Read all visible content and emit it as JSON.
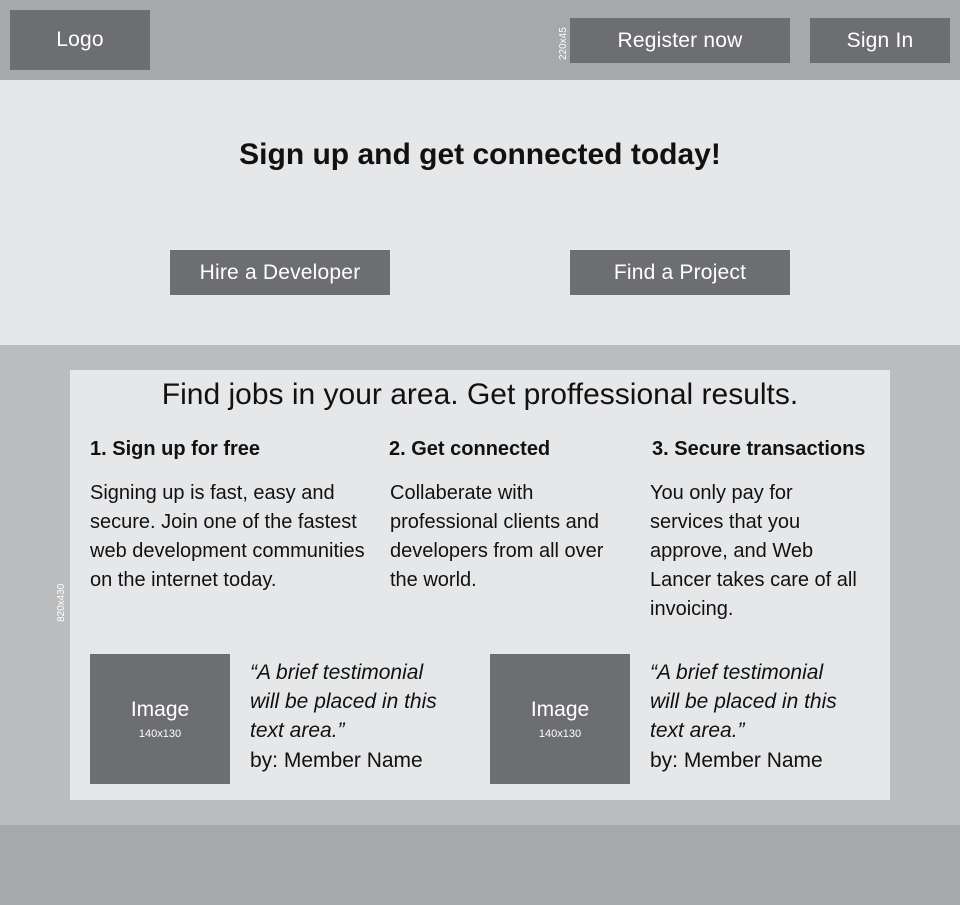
{
  "header": {
    "logo_label": "Logo",
    "register_label": "Register now",
    "signin_label": "Sign In",
    "size_annotation": "220x45"
  },
  "hero": {
    "title": "Sign up and get connected today!",
    "hire_label": "Hire a Developer",
    "find_label": "Find a Project"
  },
  "content": {
    "size_annotation": "820x430",
    "title": "Find jobs in your area.  Get proffessional results.",
    "steps": [
      {
        "title": "1. Sign up for free",
        "text": "Signing up is fast, easy and secure.  Join one of the fastest web development communities on the internet today."
      },
      {
        "title": "2. Get connected",
        "text": "Collaberate with professional clients and developers from all over the world."
      },
      {
        "title": "3. Secure transactions",
        "text": "You only pay for services that you approve, and Web Lancer takes care of all invoicing."
      }
    ],
    "testimonials": [
      {
        "image_label": "Image",
        "image_size": "140x130",
        "quote": "“A brief testimonial will be placed in this text area.”",
        "author": "by: Member Name"
      },
      {
        "image_label": "Image",
        "image_size": "140x130",
        "quote": "“A brief testimonial will be placed in this text area.”",
        "author": "by: Member Name"
      }
    ]
  },
  "colors": {
    "header_bg": "#a7a8ac",
    "hero_bg": "#e6e7e9",
    "band_bg": "#bbbcbe",
    "button_bg": "#6d6e72",
    "button_text": "#ffffff"
  }
}
